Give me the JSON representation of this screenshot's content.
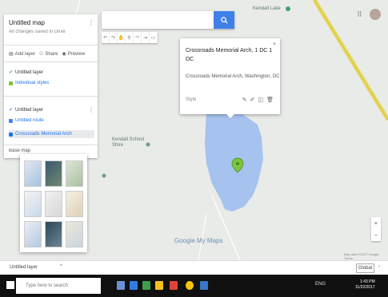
{
  "search": {
    "placeholder": ""
  },
  "toolbar": {
    "items": [
      "undo-icon",
      "redo-icon",
      "hand-icon",
      "marker-icon",
      "line-icon",
      "directions-icon",
      "ruler-icon"
    ]
  },
  "panel": {
    "title": "Untitled map",
    "subtitle": "All changes saved in Drive",
    "actions": {
      "add_layer": "Add layer",
      "share": "Share",
      "preview": "Preview"
    },
    "layer1": {
      "name": "Untitled layer",
      "styling": "Individual styles"
    },
    "layer2": {
      "name": "Untitled layer",
      "item1": "Untitled route",
      "item2": "Crossroads Memorial Arch"
    },
    "base_label": "Base map"
  },
  "card": {
    "title": "Crossroads Memorial Arch, 1 DC 1 DC",
    "description": "Crossroads Memorial Arch, Washington, DC",
    "style_label": "Style",
    "tools": [
      "paint-icon",
      "edit-icon",
      "camera-icon",
      "delete-icon"
    ]
  },
  "map": {
    "labels": [
      "Kendall Lake",
      "Kendall School Shire",
      "Crossroads Memorial Arch"
    ],
    "google_logo": "Google My Maps",
    "footer": "Map data ©2017 Google   Terms",
    "colors": {
      "water": "#a6c2ee",
      "marker": "#7cc63e",
      "road": "#e8d85a"
    }
  },
  "bottom": {
    "layer_tab": "Untitled layer",
    "right_tab": "Global"
  },
  "taskbar": {
    "search_placeholder": "Type here to search",
    "tray": "ENG",
    "time": "1:43 PM",
    "date": "11/22/2017"
  }
}
